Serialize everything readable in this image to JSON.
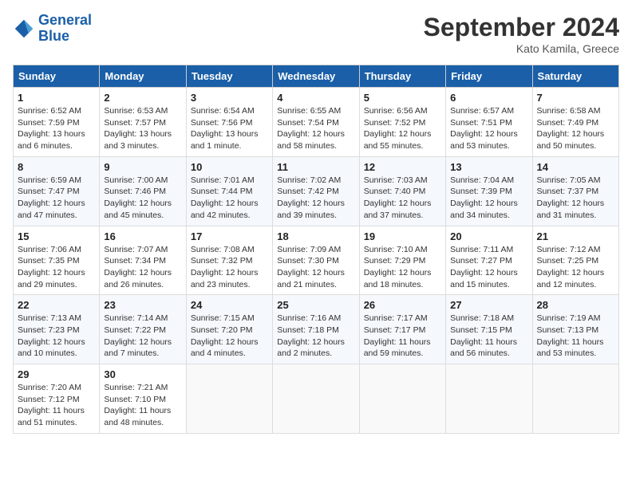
{
  "header": {
    "logo_line1": "General",
    "logo_line2": "Blue",
    "month": "September 2024",
    "location": "Kato Kamila, Greece"
  },
  "weekdays": [
    "Sunday",
    "Monday",
    "Tuesday",
    "Wednesday",
    "Thursday",
    "Friday",
    "Saturday"
  ],
  "weeks": [
    [
      {
        "day": "1",
        "info": "Sunrise: 6:52 AM\nSunset: 7:59 PM\nDaylight: 13 hours\nand 6 minutes."
      },
      {
        "day": "2",
        "info": "Sunrise: 6:53 AM\nSunset: 7:57 PM\nDaylight: 13 hours\nand 3 minutes."
      },
      {
        "day": "3",
        "info": "Sunrise: 6:54 AM\nSunset: 7:56 PM\nDaylight: 13 hours\nand 1 minute."
      },
      {
        "day": "4",
        "info": "Sunrise: 6:55 AM\nSunset: 7:54 PM\nDaylight: 12 hours\nand 58 minutes."
      },
      {
        "day": "5",
        "info": "Sunrise: 6:56 AM\nSunset: 7:52 PM\nDaylight: 12 hours\nand 55 minutes."
      },
      {
        "day": "6",
        "info": "Sunrise: 6:57 AM\nSunset: 7:51 PM\nDaylight: 12 hours\nand 53 minutes."
      },
      {
        "day": "7",
        "info": "Sunrise: 6:58 AM\nSunset: 7:49 PM\nDaylight: 12 hours\nand 50 minutes."
      }
    ],
    [
      {
        "day": "8",
        "info": "Sunrise: 6:59 AM\nSunset: 7:47 PM\nDaylight: 12 hours\nand 47 minutes."
      },
      {
        "day": "9",
        "info": "Sunrise: 7:00 AM\nSunset: 7:46 PM\nDaylight: 12 hours\nand 45 minutes."
      },
      {
        "day": "10",
        "info": "Sunrise: 7:01 AM\nSunset: 7:44 PM\nDaylight: 12 hours\nand 42 minutes."
      },
      {
        "day": "11",
        "info": "Sunrise: 7:02 AM\nSunset: 7:42 PM\nDaylight: 12 hours\nand 39 minutes."
      },
      {
        "day": "12",
        "info": "Sunrise: 7:03 AM\nSunset: 7:40 PM\nDaylight: 12 hours\nand 37 minutes."
      },
      {
        "day": "13",
        "info": "Sunrise: 7:04 AM\nSunset: 7:39 PM\nDaylight: 12 hours\nand 34 minutes."
      },
      {
        "day": "14",
        "info": "Sunrise: 7:05 AM\nSunset: 7:37 PM\nDaylight: 12 hours\nand 31 minutes."
      }
    ],
    [
      {
        "day": "15",
        "info": "Sunrise: 7:06 AM\nSunset: 7:35 PM\nDaylight: 12 hours\nand 29 minutes."
      },
      {
        "day": "16",
        "info": "Sunrise: 7:07 AM\nSunset: 7:34 PM\nDaylight: 12 hours\nand 26 minutes."
      },
      {
        "day": "17",
        "info": "Sunrise: 7:08 AM\nSunset: 7:32 PM\nDaylight: 12 hours\nand 23 minutes."
      },
      {
        "day": "18",
        "info": "Sunrise: 7:09 AM\nSunset: 7:30 PM\nDaylight: 12 hours\nand 21 minutes."
      },
      {
        "day": "19",
        "info": "Sunrise: 7:10 AM\nSunset: 7:29 PM\nDaylight: 12 hours\nand 18 minutes."
      },
      {
        "day": "20",
        "info": "Sunrise: 7:11 AM\nSunset: 7:27 PM\nDaylight: 12 hours\nand 15 minutes."
      },
      {
        "day": "21",
        "info": "Sunrise: 7:12 AM\nSunset: 7:25 PM\nDaylight: 12 hours\nand 12 minutes."
      }
    ],
    [
      {
        "day": "22",
        "info": "Sunrise: 7:13 AM\nSunset: 7:23 PM\nDaylight: 12 hours\nand 10 minutes."
      },
      {
        "day": "23",
        "info": "Sunrise: 7:14 AM\nSunset: 7:22 PM\nDaylight: 12 hours\nand 7 minutes."
      },
      {
        "day": "24",
        "info": "Sunrise: 7:15 AM\nSunset: 7:20 PM\nDaylight: 12 hours\nand 4 minutes."
      },
      {
        "day": "25",
        "info": "Sunrise: 7:16 AM\nSunset: 7:18 PM\nDaylight: 12 hours\nand 2 minutes."
      },
      {
        "day": "26",
        "info": "Sunrise: 7:17 AM\nSunset: 7:17 PM\nDaylight: 11 hours\nand 59 minutes."
      },
      {
        "day": "27",
        "info": "Sunrise: 7:18 AM\nSunset: 7:15 PM\nDaylight: 11 hours\nand 56 minutes."
      },
      {
        "day": "28",
        "info": "Sunrise: 7:19 AM\nSunset: 7:13 PM\nDaylight: 11 hours\nand 53 minutes."
      }
    ],
    [
      {
        "day": "29",
        "info": "Sunrise: 7:20 AM\nSunset: 7:12 PM\nDaylight: 11 hours\nand 51 minutes."
      },
      {
        "day": "30",
        "info": "Sunrise: 7:21 AM\nSunset: 7:10 PM\nDaylight: 11 hours\nand 48 minutes."
      },
      {
        "day": "",
        "info": ""
      },
      {
        "day": "",
        "info": ""
      },
      {
        "day": "",
        "info": ""
      },
      {
        "day": "",
        "info": ""
      },
      {
        "day": "",
        "info": ""
      }
    ]
  ]
}
